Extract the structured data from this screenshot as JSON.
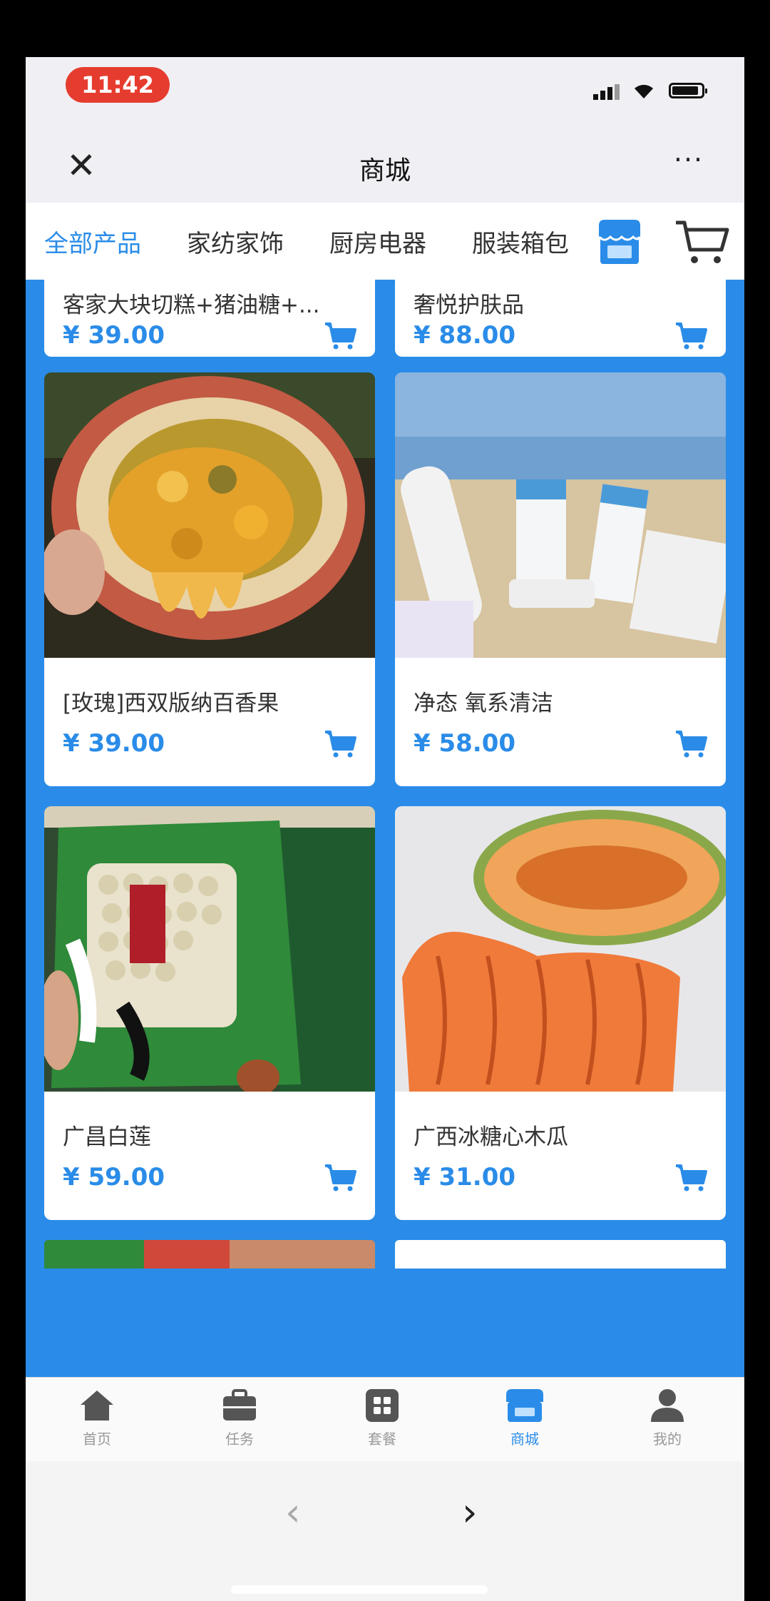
{
  "status_bar": {
    "time": "11:42"
  },
  "nav": {
    "title": "商城",
    "close": "✕",
    "more": "···"
  },
  "categories": {
    "items": [
      {
        "label": "全部产品",
        "active": true
      },
      {
        "label": "家纺家饰",
        "active": false
      },
      {
        "label": "厨房电器",
        "active": false
      },
      {
        "label": "服装箱包",
        "active": false
      }
    ]
  },
  "products": [
    {
      "name": "客家大块切糕+猪油糖+...",
      "price": "¥ 39.00"
    },
    {
      "name": "奢悦护肤品",
      "price": "¥ 88.00"
    },
    {
      "name": "[玫瑰]西双版纳百香果",
      "price": "¥ 39.00"
    },
    {
      "name": "净态 氧系清洁",
      "price": "¥ 58.00"
    },
    {
      "name": "广昌白莲",
      "price": "¥ 59.00"
    },
    {
      "name": "广西冰糖心木瓜",
      "price": "¥ 31.00"
    }
  ],
  "tabbar": {
    "items": [
      {
        "label": "首页"
      },
      {
        "label": "任务"
      },
      {
        "label": "套餐"
      },
      {
        "label": "商城"
      },
      {
        "label": "我的"
      }
    ]
  },
  "browser": {
    "back": "‹",
    "forward": "›"
  },
  "colors": {
    "accent": "#2a8ce8",
    "time_pill": "#e63c2f"
  }
}
